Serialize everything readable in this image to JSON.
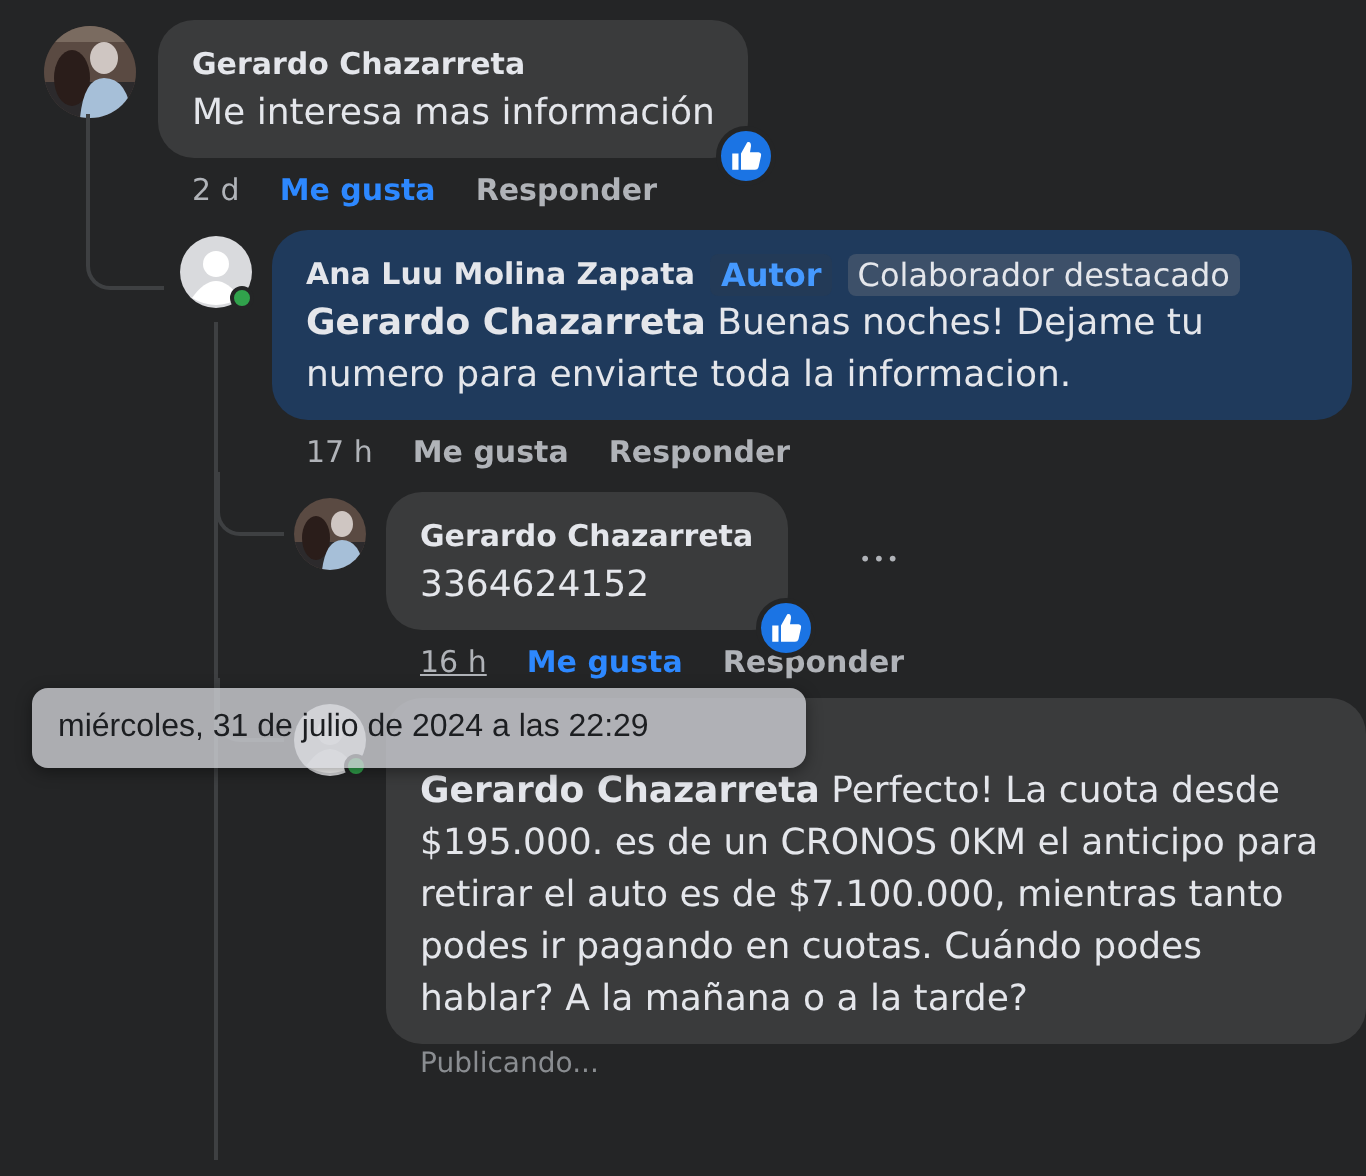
{
  "comments": [
    {
      "author": "Gerardo Chazarreta",
      "avatar": {
        "kind": "picture"
      },
      "text": "Me interesa mas información",
      "reaction": true,
      "time": "2 d",
      "time_hovered": false,
      "like": "Me gusta",
      "liked": true,
      "reply": "Responder",
      "highlighted": false,
      "children": [
        {
          "author": "Ana Luu Molina Zapata",
          "online": true,
          "highlighted": true,
          "badges": [
            {
              "label": "Autor",
              "kind": "author"
            },
            {
              "label": "Colaborador destacado",
              "kind": "top"
            }
          ],
          "text": "**Gerardo Chazarreta** Buenas noches! Dejame tu numero para enviarte toda la informacion.",
          "time": "17 h",
          "time_hovered": false,
          "like": "Me gusta",
          "liked": false,
          "reply": "Responder",
          "children": [
            {
              "author": "Gerardo Chazarreta",
              "avatar": {
                "kind": "picture"
              },
              "highlighted": false,
              "text": "3364624152",
              "reaction": true,
              "more": "•••",
              "time": "16 h",
              "time_hovered": true,
              "like": "Me gusta",
              "liked": true,
              "reply": "Responder"
            },
            {
              "online": true,
              "highlighted": false,
              "text": "**Gerardo Chazarreta** Perfecto! La cuota desde $195.000. es de un CRONOS 0KM el anticipo para retirar el auto es de $7.100.000, mientras tanto podes ir pagando en cuotas. Cuándo podes hablar? A la mañana o a la tarde?",
              "status": "Publicando...",
              "tooltip": "miércoles, 31 de julio de 2024 a las 22:29"
            }
          ]
        }
      ]
    }
  ]
}
